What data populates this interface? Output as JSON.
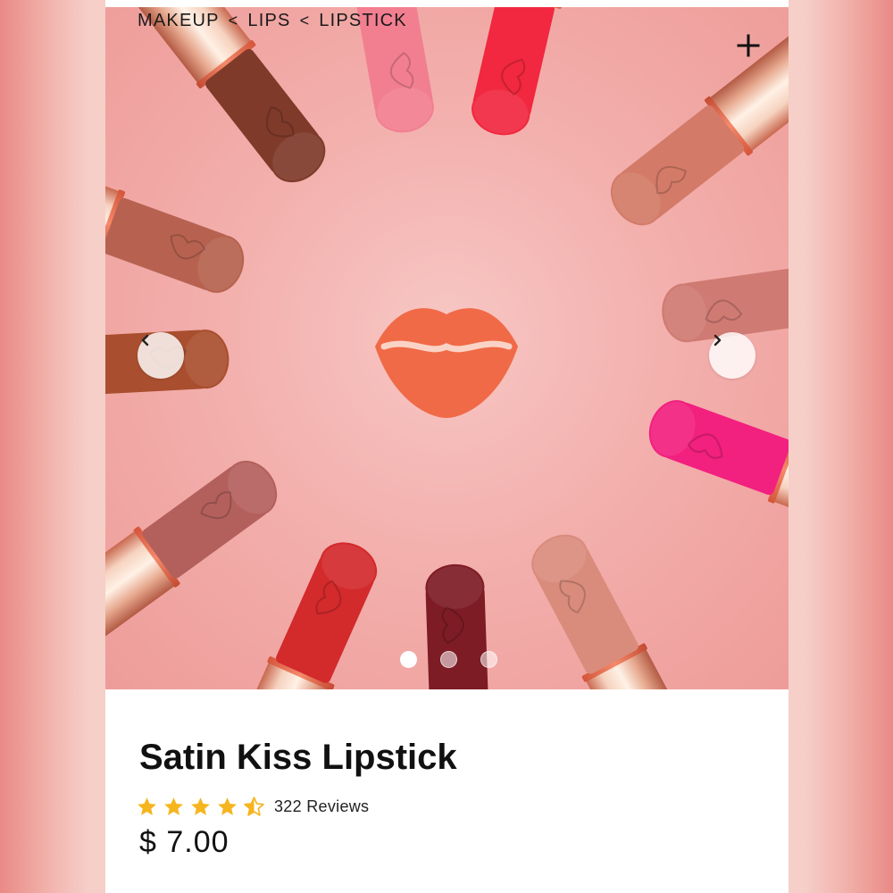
{
  "breadcrumb": {
    "items": [
      "MAKEUP",
      "LIPS",
      "LIPSTICK"
    ],
    "separator": "<"
  },
  "header": {
    "add_icon": "plus-icon"
  },
  "carousel": {
    "prev_icon": "chevron-left-icon",
    "next_icon": "chevron-right-icon",
    "slide_count": 3,
    "active_slide": 1
  },
  "product": {
    "title": "Satin Kiss Lipstick",
    "rating": 4.5,
    "rating_max": 5,
    "reviews": "322 Reviews",
    "price": "$ 7.00"
  },
  "colors": {
    "star": "#f6b51e",
    "background": "#f3b0ad",
    "text": "#111111"
  }
}
